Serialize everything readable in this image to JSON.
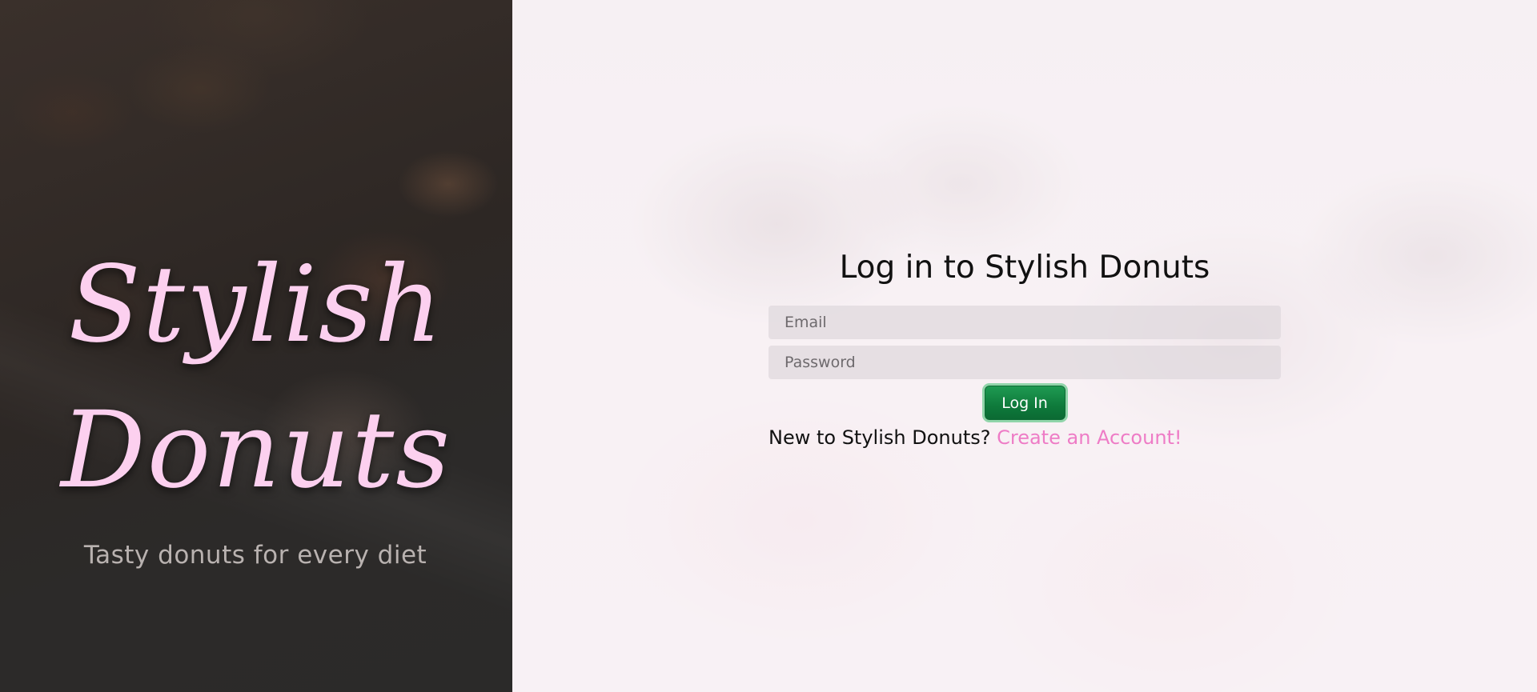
{
  "hero": {
    "title_line1": "Stylish",
    "title_line2": "Donuts",
    "tagline": "Tasty donuts for every diet"
  },
  "login": {
    "heading": "Log in to Stylish Donuts",
    "email_placeholder": "Email",
    "password_placeholder": "Password",
    "submit_label": "Log In",
    "signup_prompt": "New to Stylish Donuts?",
    "signup_link": "Create an Account!"
  },
  "colors": {
    "brand_pink": "#fcd0ef",
    "link_pink": "#ee7cc6",
    "button_green": "#0e7a3b"
  }
}
